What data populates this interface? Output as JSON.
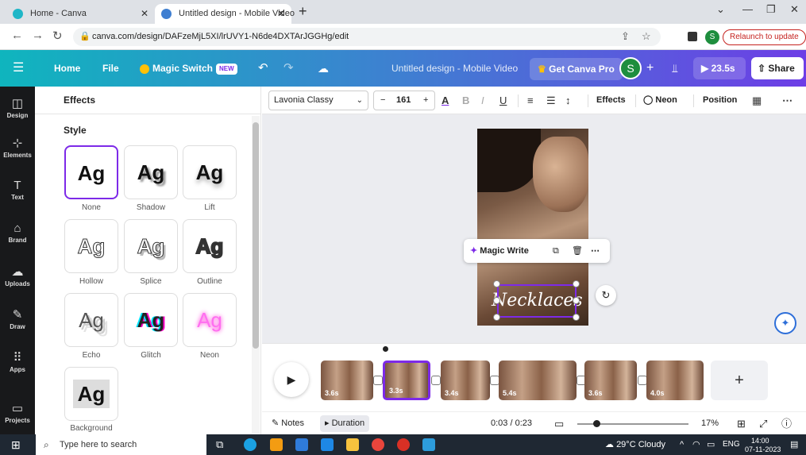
{
  "browser": {
    "tabs": [
      {
        "title": "Home - Canva"
      },
      {
        "title": "Untitled design - Mobile Video"
      }
    ],
    "url": "canva.com/design/DAFzeMjL5XI/lrUVY1-N6de4DXTArJGGHg/edit",
    "profile_initial": "S",
    "relaunch_label": "Relaunch to update"
  },
  "topbar": {
    "home": "Home",
    "file": "File",
    "magic_switch": "Magic Switch",
    "new_badge": "NEW",
    "design_title": "Untitled design - Mobile Video",
    "get_pro": "Get Canva Pro",
    "avatar_initial": "S",
    "play_time": "23.5s",
    "share": "Share"
  },
  "rail": {
    "items": [
      {
        "label": "Design"
      },
      {
        "label": "Elements"
      },
      {
        "label": "Text"
      },
      {
        "label": "Brand"
      },
      {
        "label": "Uploads"
      },
      {
        "label": "Draw"
      },
      {
        "label": "Apps"
      },
      {
        "label": "Projects"
      }
    ]
  },
  "panel": {
    "title": "Effects",
    "style_label": "Style",
    "sample_text": "Ag",
    "styles": [
      {
        "label": "None"
      },
      {
        "label": "Shadow"
      },
      {
        "label": "Lift"
      },
      {
        "label": "Hollow"
      },
      {
        "label": "Splice"
      },
      {
        "label": "Outline"
      },
      {
        "label": "Echo"
      },
      {
        "label": "Glitch"
      },
      {
        "label": "Neon"
      },
      {
        "label": "Background"
      }
    ]
  },
  "toolbar": {
    "font": "Lavonia Classy",
    "font_size": "161",
    "effects": "Effects",
    "neon": "Neon",
    "position": "Position"
  },
  "canvas": {
    "text": "Necklaces",
    "magic_write": "Magic Write"
  },
  "timeline": {
    "clips": [
      {
        "duration": "3.6s"
      },
      {
        "duration": "3.3s"
      },
      {
        "duration": "3.4s"
      },
      {
        "duration": "5.4s"
      },
      {
        "duration": "3.6s"
      },
      {
        "duration": "4.0s"
      }
    ]
  },
  "bottombar": {
    "notes": "Notes",
    "duration": "Duration",
    "time": "0:03 / 0:23",
    "zoom": "17%"
  },
  "taskbar": {
    "search_placeholder": "Type here to search",
    "weather": "29°C Cloudy",
    "lang": "ENG",
    "time": "14:00",
    "date": "07-11-2023"
  },
  "colors": {
    "accent": "#7d2ae8",
    "canva_gradient_start": "#0fb5be",
    "canva_gradient_end": "#6d3ee6"
  }
}
